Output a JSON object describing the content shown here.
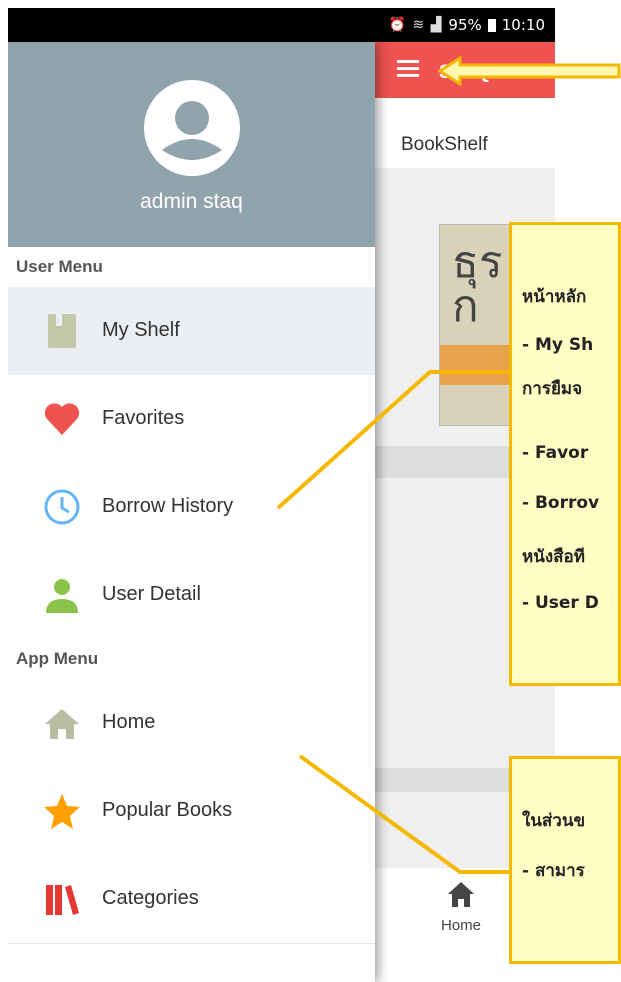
{
  "status_bar": {
    "battery": "95%",
    "time": "10:10",
    "icons": "⏰ ≋ ▟"
  },
  "app": {
    "title": "STAQ Tu",
    "tab": "BookShelf",
    "book_cover_text": "ธุร ก",
    "bottom_nav": {
      "home_label": "Home"
    }
  },
  "drawer": {
    "username": "admin staq",
    "user_menu_title": "User Menu",
    "user_menu": [
      {
        "label": "My Shelf",
        "icon": "book-icon",
        "color": "#c5c8a8"
      },
      {
        "label": "Favorites",
        "icon": "heart-icon",
        "color": "#ef5350"
      },
      {
        "label": "Borrow History",
        "icon": "clock-icon",
        "color": "#64b5f6"
      },
      {
        "label": "User Detail",
        "icon": "person-icon",
        "color": "#8bc34a"
      }
    ],
    "app_menu_title": "App Menu",
    "app_menu": [
      {
        "label": "Home",
        "icon": "home-icon",
        "color": "#b8bca0"
      },
      {
        "label": "Popular Books",
        "icon": "star-icon",
        "color": "#ffa000"
      },
      {
        "label": "Categories",
        "icon": "books-icon",
        "color": "#e53935"
      }
    ]
  },
  "annotations": {
    "callout1": [
      "หน้าหลัก",
      "- My Sh",
      "การยืมจ",
      "- Favor",
      "- Borrov",
      "หนังสือที",
      "- User D"
    ],
    "callout2": [
      "ในส่วนข",
      "- สามาร"
    ],
    "colors": {
      "accent": "#f5b800",
      "box_fill": "#fffcc4",
      "toolbar": "#ef5350",
      "drawer_header": "#90a4ae"
    }
  }
}
